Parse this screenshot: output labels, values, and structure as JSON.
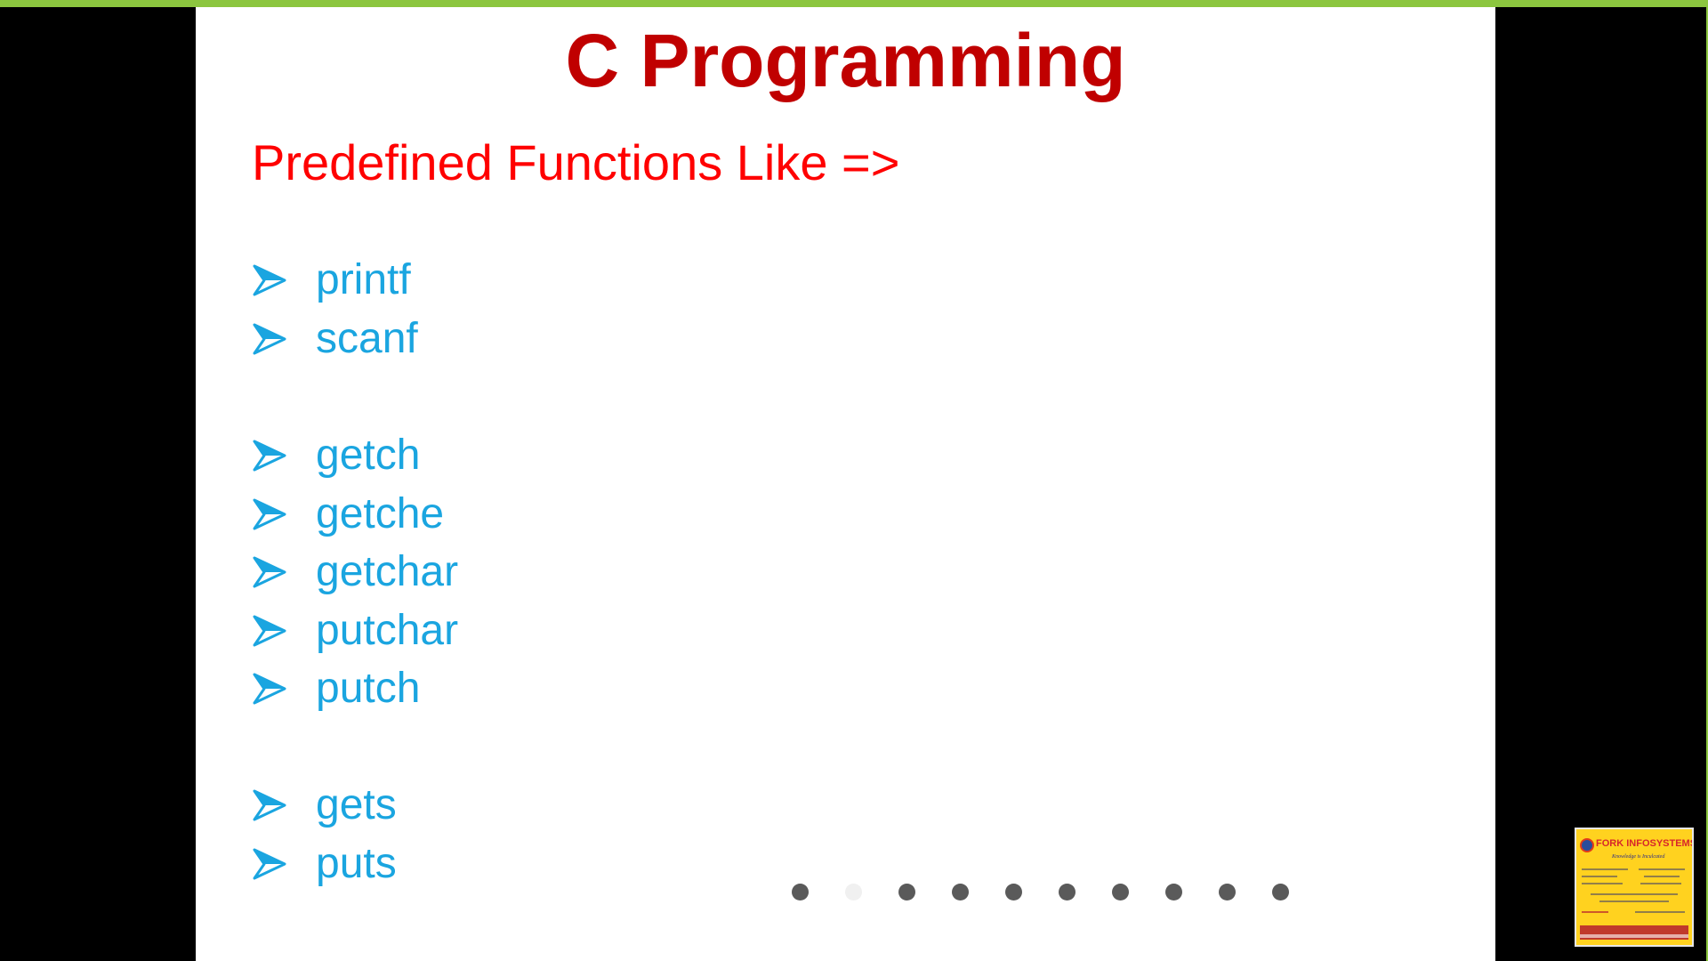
{
  "slide": {
    "title": "C Programming",
    "subtitle": "Predefined Functions Like =>",
    "functions": [
      "printf",
      "scanf",
      "getch",
      "getche",
      "getchar",
      "putchar",
      "putch",
      "gets",
      "puts"
    ]
  },
  "pagination": {
    "total_dots": 10,
    "active_index": 1
  },
  "logo": {
    "name": "FORK INFOSYSTEMS",
    "tagline": "Knowledge is Inculcated"
  },
  "colors": {
    "title": "#c00000",
    "subtitle": "#ff0000",
    "function_text": "#1aa5e0",
    "bullet": "#1aa5e0",
    "accent_bar": "#8cc63f",
    "logo_background": "#ffd21f"
  },
  "icons": {
    "bullet": "arrow-bullet-icon",
    "logo_emblem": "logo-emblem-icon"
  }
}
